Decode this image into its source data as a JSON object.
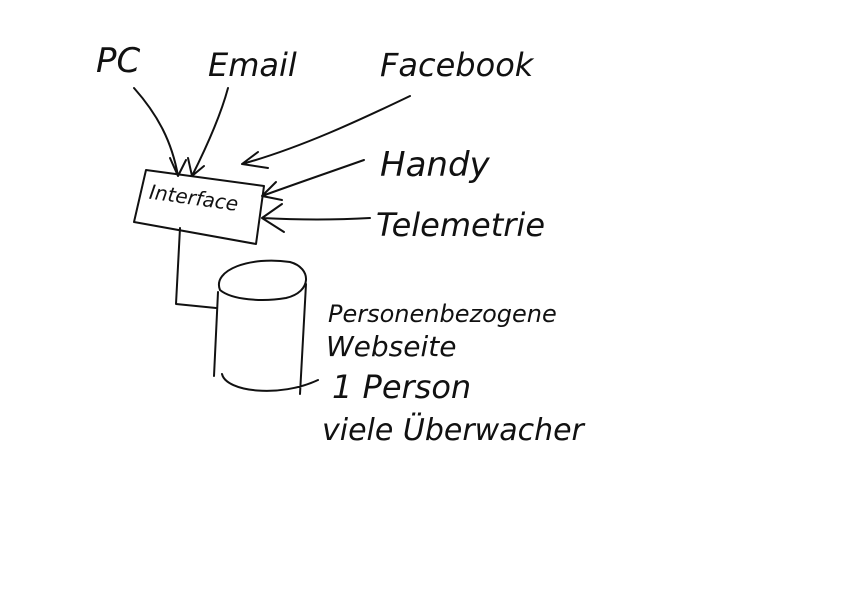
{
  "sources": {
    "pc": "PC",
    "email": "Email",
    "facebook": "Facebook",
    "handy": "Handy",
    "telemetrie": "Telemetrie"
  },
  "interface": {
    "label": "Interface"
  },
  "notes": {
    "line1": "Personenbezogene",
    "line2": "Webseite",
    "line3": "1 Person",
    "line4": "viele Überwacher"
  },
  "colors": {
    "ink": "#111111",
    "background": "#ffffff"
  }
}
